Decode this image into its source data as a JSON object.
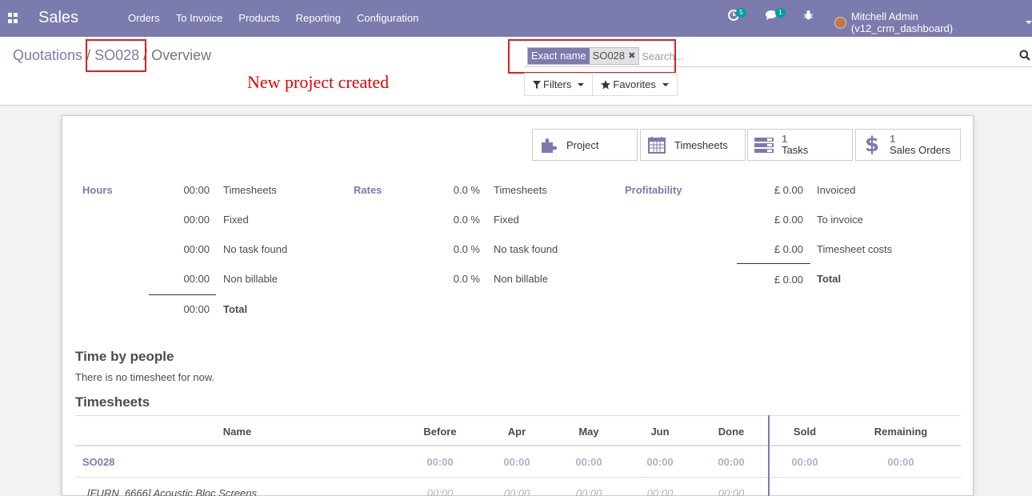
{
  "navbar": {
    "app_name": "Sales",
    "menu": [
      "Orders",
      "To Invoice",
      "Products",
      "Reporting",
      "Configuration"
    ],
    "activity_count": "5",
    "messages_count": "1",
    "user_name": "Mitchell Admin (v12_crm_dashboard)",
    "color": "#7c7bad"
  },
  "breadcrumb": {
    "first": "Quotations",
    "sep1": " / ",
    "second": "SO028",
    "sep2": " / ",
    "current": "Overview"
  },
  "annotation": "New project created",
  "search": {
    "facet_label": "Exact name",
    "facet_value": "SO028",
    "placeholder": "Search...",
    "filters_label": "Filters",
    "favorites_label": "Favorites"
  },
  "stat_buttons": {
    "project": "Project",
    "timesheets": "Timesheets",
    "tasks_count": "1",
    "tasks_label": "Tasks",
    "sales_orders_count": "1",
    "sales_orders_label": "Sales Orders"
  },
  "hours": {
    "title": "Hours",
    "rows": [
      {
        "value": "00:00",
        "label": "Timesheets"
      },
      {
        "value": "00:00",
        "label": "Fixed"
      },
      {
        "value": "00:00",
        "label": "No task found"
      },
      {
        "value": "00:00",
        "label": "Non billable"
      }
    ],
    "total_value": "00:00",
    "total_label": "Total"
  },
  "rates": {
    "title": "Rates",
    "rows": [
      {
        "value": "0.0 %",
        "label": "Timesheets"
      },
      {
        "value": "0.0 %",
        "label": "Fixed"
      },
      {
        "value": "0.0 %",
        "label": "No task found"
      },
      {
        "value": "0.0 %",
        "label": "Non billable"
      }
    ]
  },
  "profitability": {
    "title": "Profitability",
    "rows": [
      {
        "value": "£ 0.00",
        "label": "Invoiced"
      },
      {
        "value": "£ 0.00",
        "label": "To invoice"
      },
      {
        "value": "£ 0.00",
        "label": "Timesheet costs"
      }
    ],
    "total_value": "£ 0.00",
    "total_label": "Total"
  },
  "time_by_people": {
    "title": "Time by people",
    "empty_text": "There is no timesheet for now."
  },
  "timesheets_table": {
    "title": "Timesheets",
    "headers": [
      "Name",
      "Before",
      "Apr",
      "May",
      "Jun",
      "Done",
      "Sold",
      "Remaining"
    ],
    "group_row": {
      "name": "SO028",
      "values": [
        "00:00",
        "00:00",
        "00:00",
        "00:00",
        "00:00",
        "00:00",
        "00:00"
      ]
    },
    "line_row": {
      "name": "[FURN_6666] Acoustic Bloc Screens",
      "values": [
        "00:00",
        "00:00",
        "00:00",
        "00:00",
        "00:00"
      ]
    }
  }
}
